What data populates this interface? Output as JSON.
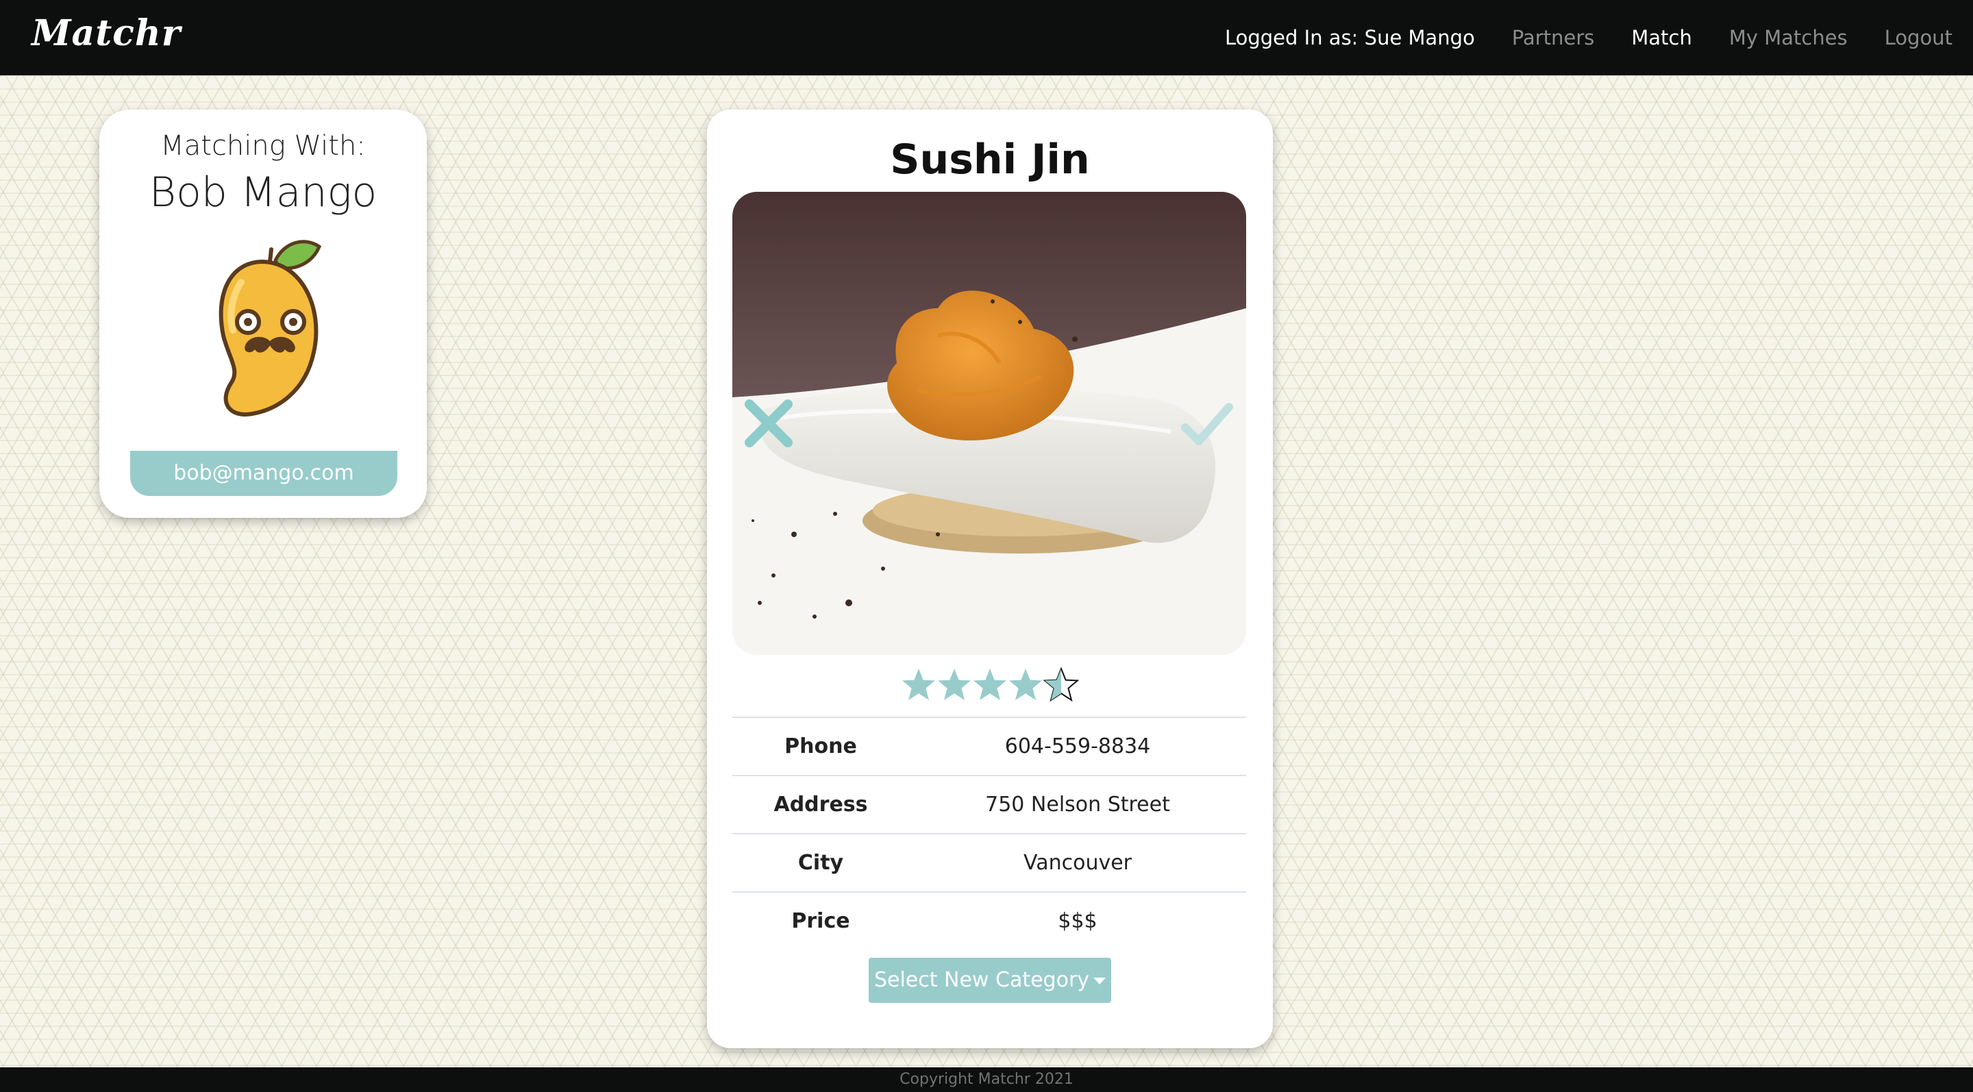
{
  "nav": {
    "brand": "Matchr",
    "user_label": "Logged In as: Sue Mango",
    "items": [
      {
        "label": "Partners",
        "active": false
      },
      {
        "label": "Match",
        "active": true
      },
      {
        "label": "My Matches",
        "active": false
      },
      {
        "label": "Logout",
        "active": false
      }
    ]
  },
  "partner": {
    "heading": "Matching With:",
    "name": "Bob Mango",
    "email": "bob@mango.com",
    "avatar_icon": "mango-mustache-icon"
  },
  "restaurant": {
    "name": "Sushi Jin",
    "photo": "sushi-uni-photo",
    "rating": 4.5,
    "rating_max": 5,
    "details": [
      {
        "label": "Phone",
        "value": "604-559-8834"
      },
      {
        "label": "Address",
        "value": "750 Nelson Street"
      },
      {
        "label": "City",
        "value": "Vancouver"
      },
      {
        "label": "Price",
        "value": "$$$"
      }
    ],
    "category_button": "Select New Category"
  },
  "footer": {
    "text": "Copyright Matchr 2021"
  },
  "colors": {
    "accent": "#98cccb",
    "navbar": "#0d0f0e",
    "background": "#f7f5ea"
  }
}
